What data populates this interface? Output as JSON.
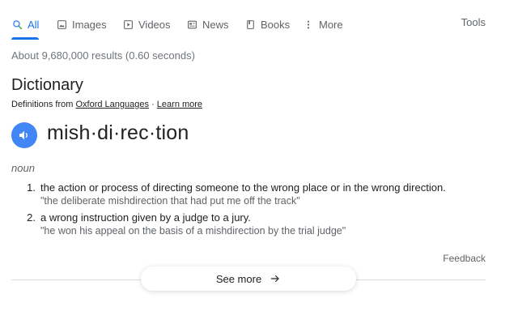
{
  "tabs": [
    {
      "label": "All",
      "icon": "search-icon",
      "active": true
    },
    {
      "label": "Images",
      "icon": "image-icon"
    },
    {
      "label": "Videos",
      "icon": "play-icon"
    },
    {
      "label": "News",
      "icon": "newspaper-icon"
    },
    {
      "label": "Books",
      "icon": "book-icon"
    },
    {
      "label": "More",
      "icon": "more-vert-icon"
    }
  ],
  "tools_label": "Tools",
  "result_stats": "About 9,680,000 results (0.60 seconds)",
  "dictionary": {
    "title": "Dictionary",
    "defs_prefix": "Definitions from",
    "source_link": "Oxford Languages",
    "separator": "·",
    "learn_more": "Learn more",
    "headword": "mish·di·rec·tion",
    "part_of_speech": "noun",
    "definitions": [
      {
        "num": "1.",
        "text": "the action or process of directing someone to the wrong place or in the wrong direction.",
        "example": "\"the deliberate mishdirection that had put me off the track\""
      },
      {
        "num": "2.",
        "text": "a wrong instruction given by a judge to a jury.",
        "example": "\"he won his appeal on the basis of a mishdirection by the trial judge\""
      }
    ]
  },
  "feedback_label": "Feedback",
  "see_more_label": "See more",
  "colors": {
    "accent": "#1a73e8",
    "speaker": "#4285f4",
    "muted": "#5f6368"
  }
}
